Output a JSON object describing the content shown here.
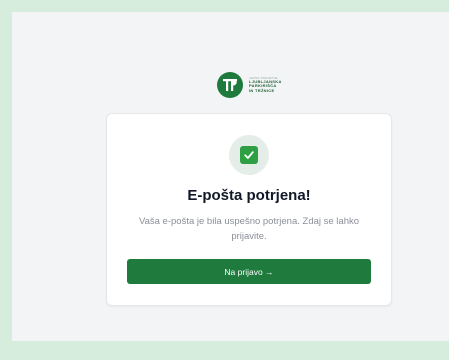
{
  "logo": {
    "tagline": "JAVNO PODJETJE",
    "lines": [
      "LJUBLJANSKA",
      "PARKIRIŠČA",
      "IN TRŽNICE"
    ]
  },
  "card": {
    "title": "E-pošta potrjena!",
    "message": "Vaša e-pošta je bila uspešno potrjena. Zdaj se lahko prijavite.",
    "button_label": "Na prijavo →"
  },
  "icons": {
    "logo": "lpt-logo-icon",
    "success": "check-icon"
  },
  "colors": {
    "brand_green": "#1f7a3e",
    "check_green": "#2ea043",
    "page_bg": "#f3f4f6",
    "frame_bg": "#d6eddd"
  }
}
